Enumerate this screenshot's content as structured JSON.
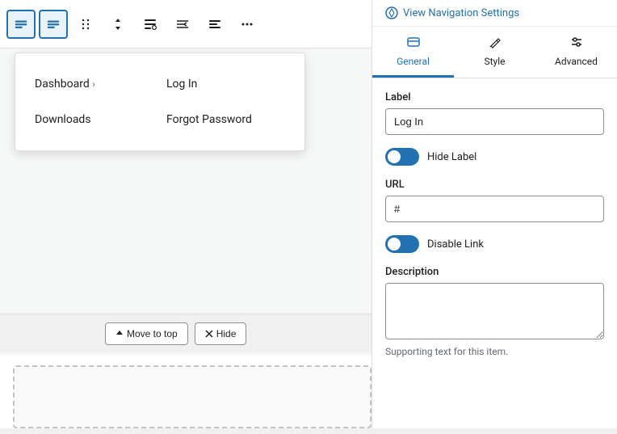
{
  "toolbar": {
    "buttons": [
      {
        "id": "nav-block-active",
        "icon": "⊟",
        "label": "Navigation block",
        "active": true
      },
      {
        "id": "nav-block-2",
        "icon": "⊟",
        "label": "Navigation block 2",
        "active": false
      },
      {
        "id": "drag-handle",
        "icon": "⠿",
        "label": "Drag",
        "active": false
      },
      {
        "id": "move-updown",
        "icon": "↕",
        "label": "Move up/down",
        "active": false
      },
      {
        "id": "add-item",
        "icon": "+",
        "label": "Add item",
        "active": false
      },
      {
        "id": "outdent",
        "icon": "⇤",
        "label": "Outdent",
        "active": false
      },
      {
        "id": "change-alignment",
        "icon": "≡",
        "label": "Change alignment",
        "active": false
      },
      {
        "id": "more-options",
        "icon": "⋯",
        "label": "More options",
        "active": false
      }
    ]
  },
  "nav_menu": {
    "items": [
      {
        "id": "dashboard",
        "label": "Dashboard",
        "hasArrow": true,
        "col": 1
      },
      {
        "id": "login",
        "label": "Log In",
        "hasArrow": false,
        "col": 2
      },
      {
        "id": "downloads",
        "label": "Downloads",
        "hasArrow": false,
        "col": 1
      },
      {
        "id": "forgot-password",
        "label": "Forgot Password",
        "hasArrow": false,
        "col": 2
      }
    ]
  },
  "bottom_bar": {
    "move_to_top_label": "Move to top",
    "hide_label": "Hide"
  },
  "right_panel": {
    "view_settings_label": "View Navigation Settings",
    "tabs": [
      {
        "id": "general",
        "label": "General",
        "icon": "⬜",
        "active": true
      },
      {
        "id": "style",
        "label": "Style",
        "icon": "✏️",
        "active": false
      },
      {
        "id": "advanced",
        "label": "Advanced",
        "icon": "⚙",
        "active": false
      }
    ],
    "settings": {
      "label_field": {
        "label": "Label",
        "value": "Log In",
        "placeholder": ""
      },
      "hide_label_toggle": {
        "label": "Hide Label",
        "enabled": true
      },
      "url_field": {
        "label": "URL",
        "value": "#",
        "placeholder": ""
      },
      "disable_link_toggle": {
        "label": "Disable Link",
        "enabled": true
      },
      "description_field": {
        "label": "Description",
        "value": "",
        "placeholder": "",
        "help_text": "Supporting text for this item."
      }
    }
  }
}
